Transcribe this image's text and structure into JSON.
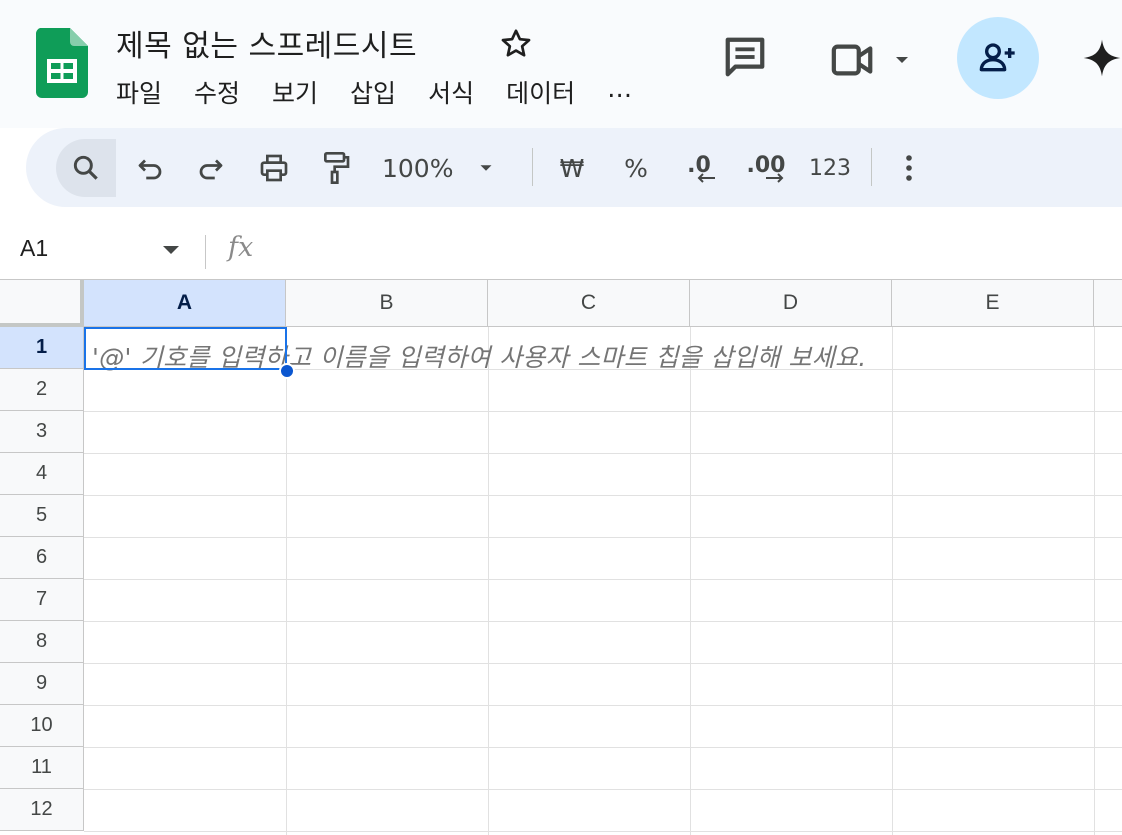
{
  "app": {
    "doc_title": "제목 없는 스프레드시트",
    "menu": [
      "파일",
      "수정",
      "보기",
      "삽입",
      "서식",
      "데이터",
      "…"
    ],
    "icons": {
      "logo": "google-sheets-logo",
      "star": "star-icon",
      "comment": "comment-icon",
      "meet": "video-camera-icon",
      "share": "add-person-icon",
      "gemini": "gemini-sparkle-icon"
    },
    "colors": {
      "sheets_green": "#0f9d58",
      "share_bg": "#c2e7ff",
      "selection_blue": "#1a73e8",
      "header_selected_bg": "#d3e3fd"
    }
  },
  "toolbar": {
    "zoom": "100%",
    "currency": "₩",
    "percent": "%",
    "decrease_decimal": ".0",
    "increase_decimal": ".00",
    "number_format": "123"
  },
  "formula_bar": {
    "name_box": "A1",
    "fx_label": "fx",
    "formula_value": ""
  },
  "sheet": {
    "columns": [
      "A",
      "B",
      "C",
      "D",
      "E"
    ],
    "rows": [
      "1",
      "2",
      "3",
      "4",
      "5",
      "6",
      "7",
      "8",
      "9",
      "10",
      "11",
      "12"
    ],
    "selected_cell": "A1",
    "cell_placeholder": "'@' 기호를 입력하고 이름을 입력하여 사용자 스마트 칩을 삽입해 보세요."
  }
}
